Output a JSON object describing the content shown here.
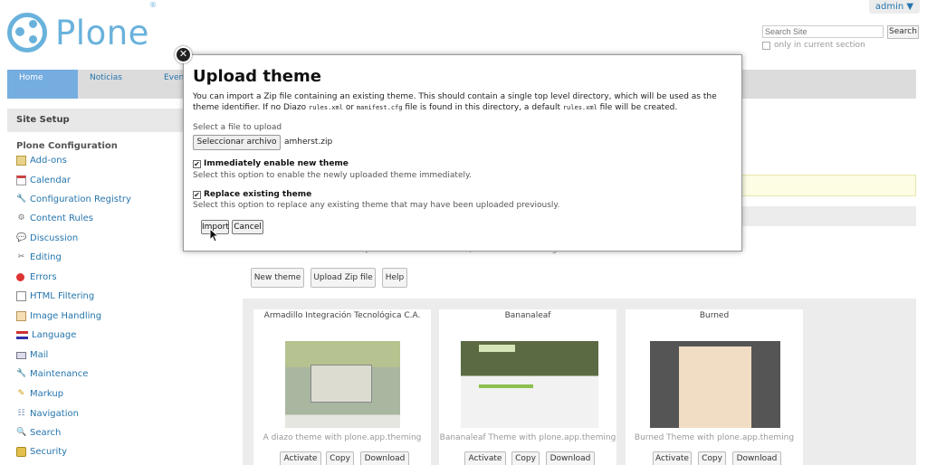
{
  "header": {
    "admin_label": "admin ▼",
    "logo_text": "Plone",
    "logo_reg": "®",
    "search_placeholder": "Search Site",
    "search_button": "Search",
    "only_current_section": "only in current section"
  },
  "nav": {
    "items": [
      {
        "label": "Home"
      },
      {
        "label": "Noticias"
      },
      {
        "label": "Even"
      }
    ]
  },
  "sidebar": {
    "title": "Site Setup",
    "section_title": "Plone Configuration",
    "items": [
      {
        "label": "Add-ons",
        "icon": "addons-icon"
      },
      {
        "label": "Calendar",
        "icon": "calendar-icon"
      },
      {
        "label": "Configuration Registry",
        "icon": "wrench-icon"
      },
      {
        "label": "Content Rules",
        "icon": "content-rules-icon"
      },
      {
        "label": "Discussion",
        "icon": "discussion-icon"
      },
      {
        "label": "Editing",
        "icon": "scissors-icon"
      },
      {
        "label": "Errors",
        "icon": "error-icon"
      },
      {
        "label": "HTML Filtering",
        "icon": "html-filter-icon"
      },
      {
        "label": "Image Handling",
        "icon": "image-icon"
      },
      {
        "label": "Language",
        "icon": "flag-icon"
      },
      {
        "label": "Mail",
        "icon": "mail-icon"
      },
      {
        "label": "Maintenance",
        "icon": "maintenance-icon"
      },
      {
        "label": "Markup",
        "icon": "pencil-icon"
      },
      {
        "label": "Navigation",
        "icon": "navigation-icon"
      },
      {
        "label": "Search",
        "icon": "search-icon"
      },
      {
        "label": "Security",
        "icon": "lock-icon"
      }
    ]
  },
  "main": {
    "intro_text": "Use the buttons to create or upload a new Diazo theme, or select an existing theme from a list below.",
    "buttons": {
      "new_theme": "New theme",
      "upload_zip": "Upload Zip file",
      "help": "Help"
    },
    "themes": [
      {
        "title": "Armadillo Integración Tecnológica C.A.",
        "description": "A diazo theme with plone.app.theming"
      },
      {
        "title": "Bananaleaf",
        "description": "Bananaleaf Theme with plone.app.theming"
      },
      {
        "title": "Burned",
        "description": "Burned Theme with plone.app.theming"
      }
    ],
    "theme_actions": {
      "activate": "Activate",
      "copy": "Copy",
      "download": "Download"
    }
  },
  "modal": {
    "close_glyph": "✕",
    "title": "Upload theme",
    "desc_1": "You can import a Zip file containing an existing theme. This should contain a single top level directory, which will be used as the theme identifier. If no Diazo ",
    "desc_code_1": "rules.xml",
    "desc_2": " or ",
    "desc_code_2": "manifest.cfg",
    "desc_3": " file is found in this directory, a default ",
    "desc_code_3": "rules.xml",
    "desc_4": " file will be created.",
    "file_label": "Select a file to upload",
    "file_button": "Seleccionar archivo",
    "file_name": "amherst.zip",
    "enable_label": "Immediately enable new theme",
    "enable_help": "Select this option to enable the newly uploaded theme immediately.",
    "enable_checked": true,
    "replace_label": "Replace existing theme",
    "replace_help": "Select this option to replace any existing theme that may have been uploaded previously.",
    "replace_checked": true,
    "check_glyph": "✔",
    "import_button": "Import",
    "cancel_button": "Cancel"
  },
  "colors": {
    "brand": "#69b2dc",
    "link": "#2575ad",
    "nav_active": "#75ade0"
  }
}
